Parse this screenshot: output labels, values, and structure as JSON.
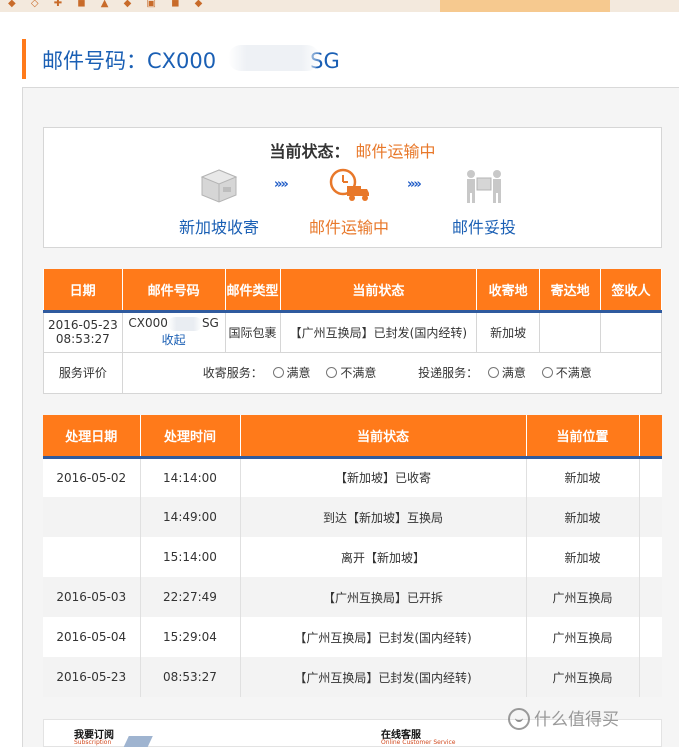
{
  "header": {
    "title_prefix": "邮件号码：CX000",
    "title_suffix": "SG"
  },
  "status": {
    "label": "当前状态：",
    "value": "邮件运输中",
    "steps": [
      {
        "label": "新加坡收寄",
        "icon": "box-icon",
        "color": "#1a5fb4"
      },
      {
        "label": "邮件运输中",
        "icon": "truck-clock-icon",
        "color": "#e8782a"
      },
      {
        "label": "邮件妥投",
        "icon": "delivery-person-icon",
        "color": "#1a5fb4"
      }
    ],
    "arrow": "»»"
  },
  "summary_table": {
    "headers": [
      "日期",
      "邮件号码",
      "邮件类型",
      "当前状态",
      "收寄地",
      "寄达地",
      "签收人"
    ],
    "row": {
      "date": "2016-05-23 08:53:27",
      "number_prefix": "CX000",
      "number_suffix": "SG",
      "collapse_link": "收起",
      "type": "国际包裹",
      "status": "【广州互换局】已封发(国内经转)",
      "origin": "新加坡",
      "destination": "",
      "signer": ""
    },
    "rating": {
      "label": "服务评价",
      "pickup_label": "收寄服务：",
      "delivery_label": "投递服务：",
      "satisfied": "满意",
      "unsatisfied": "不满意"
    }
  },
  "tracking_table": {
    "headers": [
      "处理日期",
      "处理时间",
      "当前状态",
      "当前位置"
    ],
    "rows": [
      {
        "date": "2016-05-02",
        "time": "14:14:00",
        "status": "【新加坡】已收寄",
        "location": "新加坡"
      },
      {
        "date": "",
        "time": "14:49:00",
        "status": "到达【新加坡】互换局",
        "location": "新加坡"
      },
      {
        "date": "",
        "time": "15:14:00",
        "status": "离开【新加坡】",
        "location": "新加坡"
      },
      {
        "date": "2016-05-03",
        "time": "22:27:49",
        "status": "【广州互换局】已开拆",
        "location": "广州互换局"
      },
      {
        "date": "2016-05-04",
        "time": "15:29:04",
        "status": "【广州互换局】已封发(国内经转)",
        "location": "广州互换局"
      },
      {
        "date": "2016-05-23",
        "time": "08:53:27",
        "status": "【广州互换局】已封发(国内经转)",
        "location": "广州互换局"
      }
    ]
  },
  "footer": {
    "subscribe_cn": "我要订阅",
    "subscribe_en": "Subscription",
    "service_cn": "在线客服",
    "service_en": "Online Customer Service"
  },
  "watermark": {
    "text": "什么值得买"
  },
  "colors": {
    "accent": "#ff7a1a",
    "header_rule": "#2f5a9e",
    "link": "#1a5fb4",
    "status_orange": "#e8782a"
  }
}
